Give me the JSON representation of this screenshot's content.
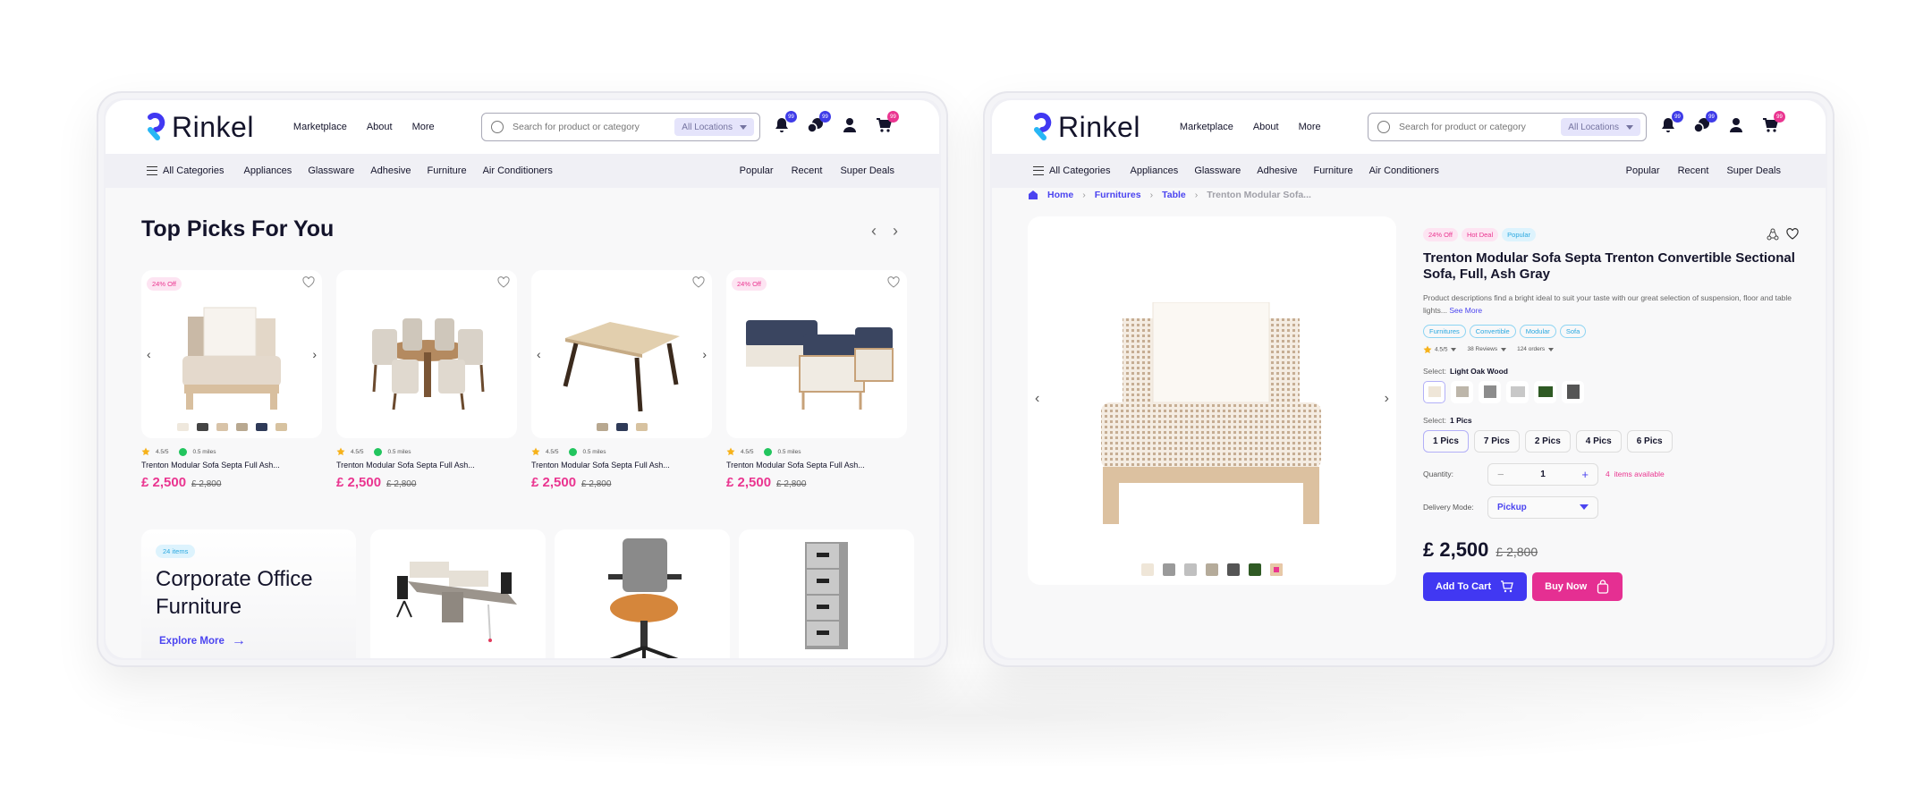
{
  "brand": {
    "name": "Rinkel",
    "primary": "#4138f2",
    "accent": "#ea3590",
    "cyan": "#2aa8e0"
  },
  "header": {
    "nav": [
      "Marketplace",
      "About",
      "More"
    ],
    "search_placeholder": "Search for product or category",
    "location": "All Locations",
    "badges": {
      "notifications": "99",
      "messages": "99",
      "cart": "99"
    }
  },
  "catbar": {
    "all_label": "All Categories",
    "categories": [
      "Appliances",
      "Glassware",
      "Adhesive",
      "Furniture",
      "Air Conditioners"
    ],
    "right": [
      "Popular",
      "Recent",
      "Super Deals"
    ]
  },
  "listing": {
    "title": "Top Picks For You",
    "cards": [
      {
        "badge": "24% Off",
        "rating": "4.5/5",
        "distance": "0.5 miles",
        "name": "Trenton Modular Sofa Septa Full Ash...",
        "price": "£ 2,500",
        "old_price": "£ 2,800"
      },
      {
        "badge": "",
        "rating": "4.5/5",
        "distance": "0.5 miles",
        "name": "Trenton Modular Sofa Septa Full Ash...",
        "price": "£ 2,500",
        "old_price": "£ 2,800"
      },
      {
        "badge": "",
        "rating": "4.5/5",
        "distance": "0.5 miles",
        "name": "Trenton Modular Sofa Septa Full Ash...",
        "price": "£ 2,500",
        "old_price": "£ 2,800"
      },
      {
        "badge": "24% Off",
        "rating": "4.5/5",
        "distance": "0.5 miles",
        "name": "Trenton Modular Sofa Septa Full Ash...",
        "price": "£ 2,500",
        "old_price": "£ 2,800"
      }
    ],
    "promo": {
      "count": "24 items",
      "title_1": "Corporate Office",
      "title_2": "Furniture",
      "cta": "Explore More"
    }
  },
  "product": {
    "breadcrumb": [
      "Home",
      "Furnitures",
      "Table",
      "Trenton Modular Sofa..."
    ],
    "tags": [
      "24% Off",
      "Hot Deal",
      "Popular"
    ],
    "title": "Trenton Modular Sofa Septa Trenton Convertible Sectional Sofa, Full, Ash Gray",
    "description": "Product descriptions find a bright ideal to suit your taste with our great selection of suspension, floor and table lights...",
    "see_more": "See More",
    "categories": [
      "Furnitures",
      "Convertible",
      "Modular",
      "Sofa"
    ],
    "rating": "4.5/5",
    "reviews": "38 Reviews",
    "orders": "124 orders",
    "select_label": "Select:",
    "selected_variant": "Light Oak Wood",
    "selected_pack": "1 Pics",
    "packs": [
      "1 Pics",
      "7 Pics",
      "2 Pics",
      "4 Pics",
      "6 Pics"
    ],
    "quantity_label": "Quantity:",
    "quantity": "1",
    "available_count": "4",
    "available_text": "items available",
    "delivery_label": "Delivery Mode:",
    "delivery_mode": "Pickup",
    "price": "£ 2,500",
    "old_price": "£ 2,800",
    "add_to_cart": "Add To Cart",
    "buy_now": "Buy Now"
  }
}
